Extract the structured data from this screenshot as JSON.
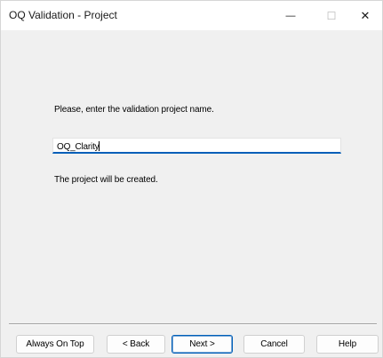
{
  "window": {
    "title": "OQ Validation - Project",
    "minimize_glyph": "—",
    "maximize_glyph": "☐",
    "close_glyph": "✕"
  },
  "main": {
    "prompt": "Please, enter the validation project name.",
    "project_name_value": "OQ_Clarity",
    "status_text": "The project will be created."
  },
  "buttons": {
    "always_on_top": "Always On Top",
    "back": "< Back",
    "next": "Next >",
    "cancel": "Cancel",
    "help": "Help"
  },
  "colors": {
    "accent": "#005fb8",
    "dialog_background": "#f0f0f0",
    "titlebar_background": "#ffffff"
  }
}
